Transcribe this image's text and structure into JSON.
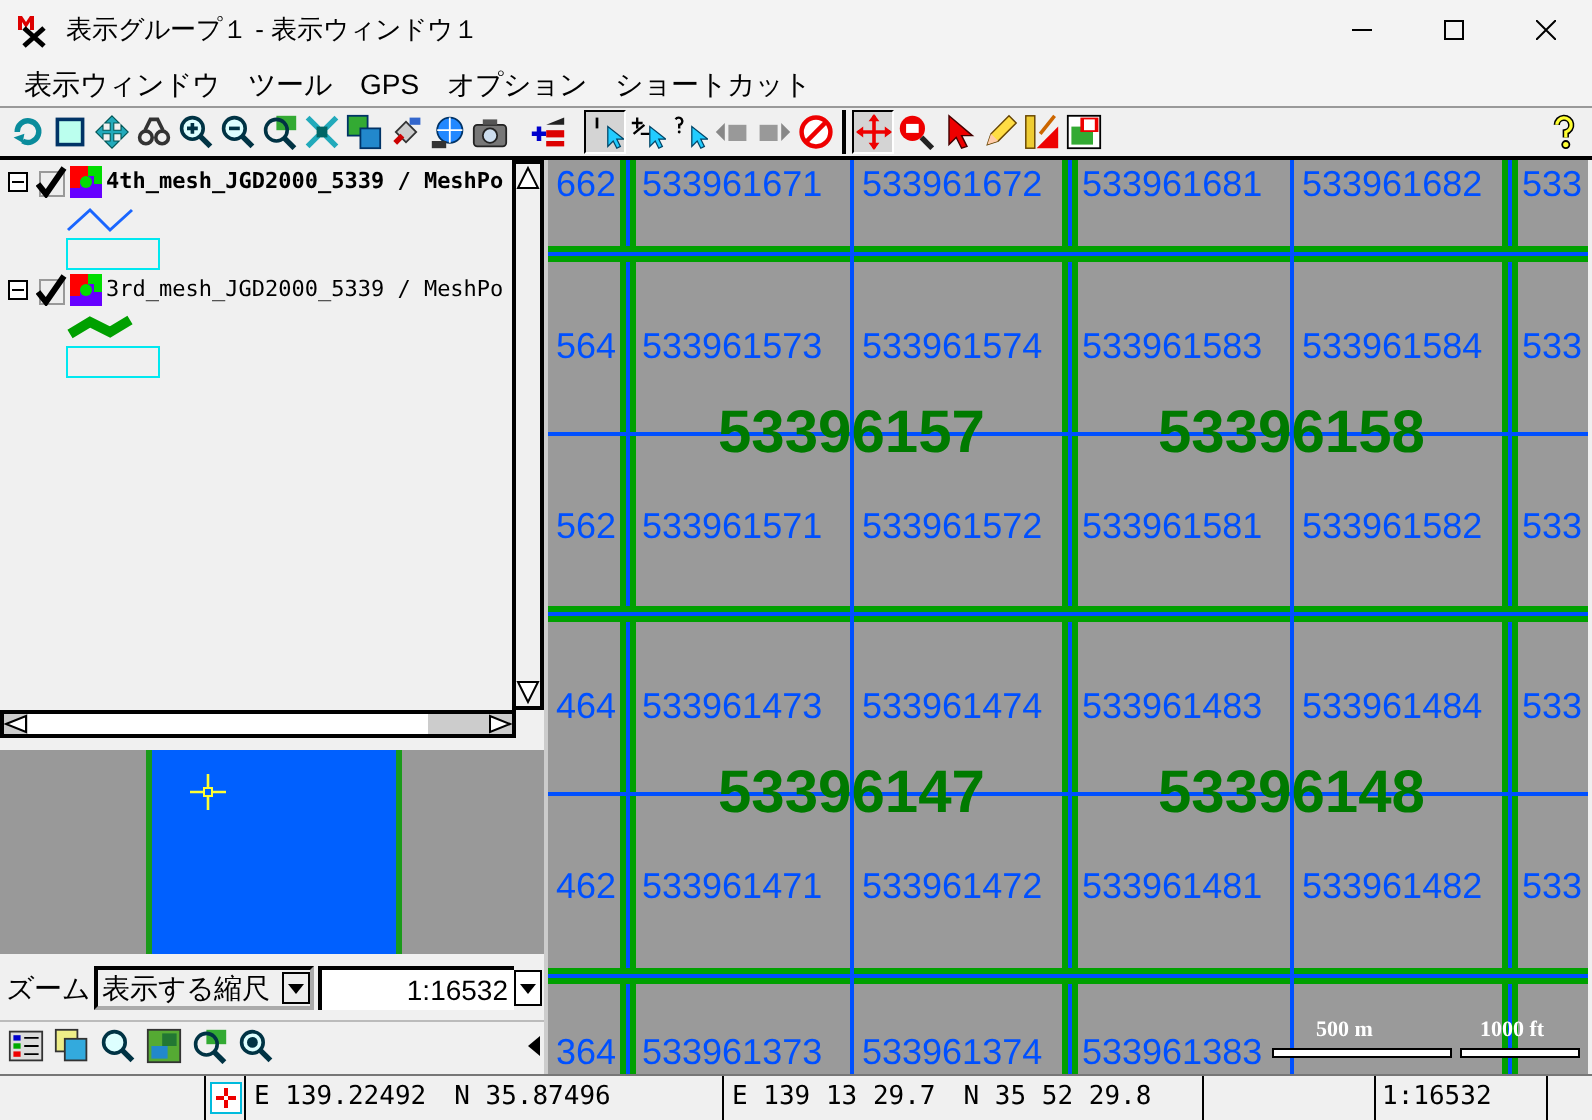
{
  "window": {
    "title": "表示グループ１ - 表示ウィンドウ１"
  },
  "menu": [
    "表示ウィンドウ",
    "ツール",
    "GPS",
    "オプション",
    "ショートカット"
  ],
  "toolbar": [
    {
      "kind": "refresh",
      "selected": false
    },
    {
      "kind": "frame",
      "selected": false
    },
    {
      "kind": "pan",
      "selected": false
    },
    {
      "kind": "binoculars",
      "selected": false
    },
    {
      "kind": "zoom_in",
      "selected": false
    },
    {
      "kind": "zoom_out",
      "selected": false
    },
    {
      "kind": "zoom_layer",
      "selected": false
    },
    {
      "kind": "shrink",
      "selected": false
    },
    {
      "kind": "tiles",
      "selected": false
    },
    {
      "kind": "satellite",
      "selected": false
    },
    {
      "kind": "globe",
      "selected": false
    },
    {
      "kind": "camera",
      "selected": false
    },
    {
      "kind": "gap"
    },
    {
      "kind": "add_layer",
      "selected": false
    },
    {
      "kind": "gap"
    },
    {
      "kind": "select_one",
      "selected": true
    },
    {
      "kind": "select_plus",
      "selected": false
    },
    {
      "kind": "query",
      "selected": false
    },
    {
      "kind": "back",
      "selected": false
    },
    {
      "kind": "forward",
      "selected": false
    },
    {
      "kind": "no_entry",
      "selected": false
    },
    {
      "kind": "separator"
    },
    {
      "kind": "move",
      "selected": true
    },
    {
      "kind": "zoom_box",
      "selected": false
    },
    {
      "kind": "pointer",
      "selected": false
    },
    {
      "kind": "pencil",
      "selected": false
    },
    {
      "kind": "ruler",
      "selected": false
    },
    {
      "kind": "map_frame",
      "selected": false
    },
    {
      "kind": "spacer"
    },
    {
      "kind": "help",
      "selected": false
    }
  ],
  "layers": [
    {
      "name": "4th_mesh_JGD2000_5339 / MeshPo",
      "expanded": true,
      "checked": true,
      "selected": true,
      "kind": "thin",
      "color": "#1a66ff"
    },
    {
      "name": "3rd_mesh_JGD2000_5339 / MeshPo",
      "expanded": true,
      "checked": true,
      "selected": false,
      "kind": "thick",
      "color": "#00a000"
    }
  ],
  "zoom": {
    "label": "ズーム",
    "mode": "表示する縮尺",
    "scale": "1:16532"
  },
  "bottom_tools": [
    {
      "kind": "legend"
    },
    {
      "kind": "layers"
    },
    {
      "kind": "search"
    },
    {
      "kind": "map"
    },
    {
      "kind": "zoom_map"
    },
    {
      "kind": "zoom_target"
    }
  ],
  "map": {
    "label_rows": [
      [
        "662",
        "533961671",
        "533961672",
        "533961681",
        "533961682",
        "533"
      ],
      [
        "564",
        "533961573",
        "533961574",
        "533961583",
        "533961584",
        "533"
      ],
      [
        "562",
        "533961571",
        "533961572",
        "533961581",
        "533961582",
        "533"
      ],
      [
        "464",
        "533961473",
        "533961474",
        "533961483",
        "533961484",
        "533"
      ],
      [
        "462",
        "533961471",
        "533961472",
        "533961481",
        "533961482",
        "533"
      ],
      [
        "364",
        "533961373",
        "533961374",
        "533961383"
      ]
    ],
    "big_labels": [
      [
        "53396157",
        "53396158"
      ],
      [
        "53396147",
        "53396148"
      ]
    ],
    "scale_bar": {
      "metric": "500 m",
      "imperial": "1000 ft"
    }
  },
  "status_bar": {
    "decimal_e": "E 139.22492",
    "decimal_n": "N 35.87496",
    "dms_e": "E 139 13 29.7",
    "dms_n": "N 35 52 29.8",
    "scale": "1:16532"
  }
}
